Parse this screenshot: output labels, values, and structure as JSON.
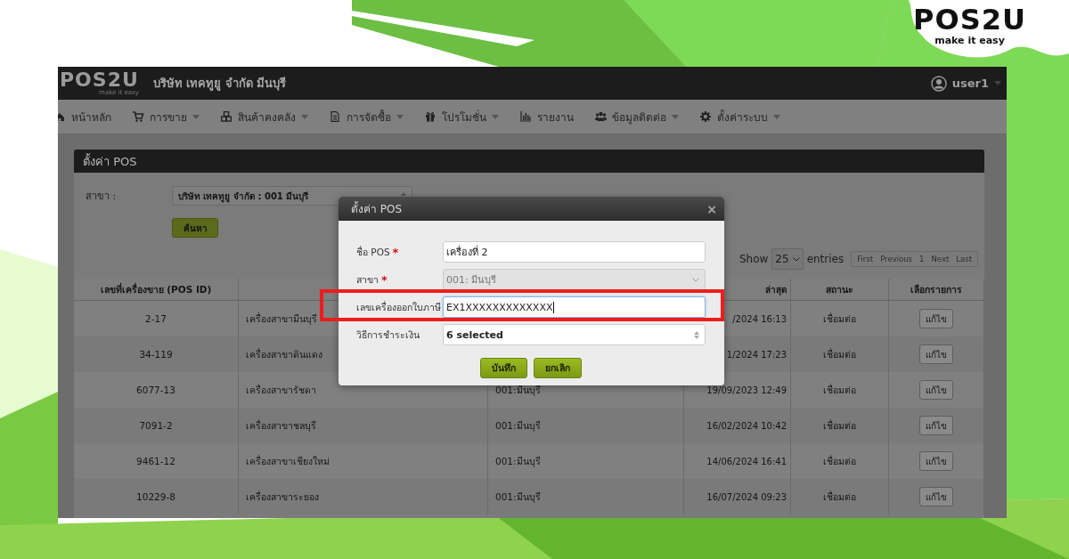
{
  "brand": {
    "logo": "POS2U",
    "tagline": "make it easy"
  },
  "app": {
    "logo": "POS2U",
    "logo_tagline": "make it easy",
    "company": "บริษัท เทคทูยู จำกัด มีนบุรี",
    "user": "user1"
  },
  "nav": [
    {
      "label": "หน้าหลัก",
      "kind": "home",
      "dropdown": false
    },
    {
      "label": "การขาย",
      "kind": "cart",
      "dropdown": true
    },
    {
      "label": "สินค้าคงคลัง",
      "kind": "cubes",
      "dropdown": true
    },
    {
      "label": "การจัดซื้อ",
      "kind": "document",
      "dropdown": true
    },
    {
      "label": "โปรโมชั่น",
      "kind": "gift",
      "dropdown": true
    },
    {
      "label": "รายงาน",
      "kind": "chart",
      "dropdown": false
    },
    {
      "label": "ข้อมูลติดต่อ",
      "kind": "users",
      "dropdown": true
    },
    {
      "label": "ตั้งค่าระบบ",
      "kind": "gear",
      "dropdown": true
    }
  ],
  "panel": {
    "title": "ตั้งค่า POS",
    "branch_label": "สาขา :",
    "branch_value": "บริษัท เทคทูยู จำกัด : 001 มีนบุรี",
    "search_button": "ค้นหา",
    "show_label": "Show",
    "page_size": "25",
    "entries_label": "entries",
    "pagination": [
      {
        "label": "First",
        "disabled": true
      },
      {
        "label": "Previous",
        "disabled": true
      },
      {
        "label": "1",
        "disabled": true
      },
      {
        "label": "Next",
        "disabled": true
      },
      {
        "label": "Last",
        "disabled": true
      }
    ]
  },
  "table": {
    "columns": [
      {
        "label": "เลขที่เครื่องขาย (POS ID)"
      },
      {},
      {},
      {
        "label": "ล่าสุด"
      },
      {
        "label": "สถานะ"
      },
      {
        "label": "เลือกรายการ"
      }
    ],
    "rows": [
      {
        "pos_id": "2-17",
        "name": "เครื่องสาขามีนบุรี",
        "last_connected": "/2024 16:13",
        "status": "เชื่อมต่อ",
        "action": "แก้ไข"
      },
      {
        "pos_id": "34-119",
        "name": "เครื่องสาขาดินแดง",
        "last_connected": "1/2024 17:23",
        "status": "เชื่อมต่อ",
        "action": "แก้ไข"
      },
      {
        "pos_id": "6077-13",
        "name": "เครื่องสาขารัชดา",
        "branch": "001:มีนบุรี",
        "last_connected": "19/09/2023 12:49",
        "status": "เชื่อมต่อ",
        "action": "แก้ไข"
      },
      {
        "pos_id": "7091-2",
        "name": "เครื่องสาขาชลบุรี",
        "branch": "001:มีนบุรี",
        "last_connected": "16/02/2024 10:42",
        "status": "เชื่อมต่อ",
        "action": "แก้ไข"
      },
      {
        "pos_id": "9461-12",
        "name": "เครื่องสาขาเชียงใหม่",
        "branch": "001:มีนบุรี",
        "last_connected": "14/06/2024 16:41",
        "status": "เชื่อมต่อ",
        "action": "แก้ไข"
      },
      {
        "pos_id": "10229-8",
        "name": "เครื่องสาขาระยอง",
        "branch": "001:มีนบุรี",
        "last_connected": "16/07/2024 09:23",
        "status": "เชื่อมต่อ",
        "action": "แก้ไข"
      }
    ]
  },
  "modal": {
    "title": "ตั้งค่า POS",
    "close": "×",
    "fields": [
      {
        "kind": "text",
        "label": "ชื่อ POS",
        "required_mark": "*",
        "value": "เครื่องที่ 2",
        "disabled": false,
        "focused": false
      },
      {
        "kind": "select",
        "label": "สาขา",
        "required_mark": "*",
        "value": "001: มีนบุรี",
        "disabled": true,
        "focused": false
      },
      {
        "kind": "text",
        "label": "เลขเครื่องออกใบภาษี",
        "value": "EX1XXXXXXXXXXXXX",
        "disabled": false,
        "focused": true
      },
      {
        "kind": "multiselect",
        "label": "วิธีการชำระเงิน",
        "value": "6 selected",
        "disabled": false,
        "focused": false
      }
    ],
    "buttons": [
      "บันทึก",
      "ยกเลิก"
    ]
  }
}
